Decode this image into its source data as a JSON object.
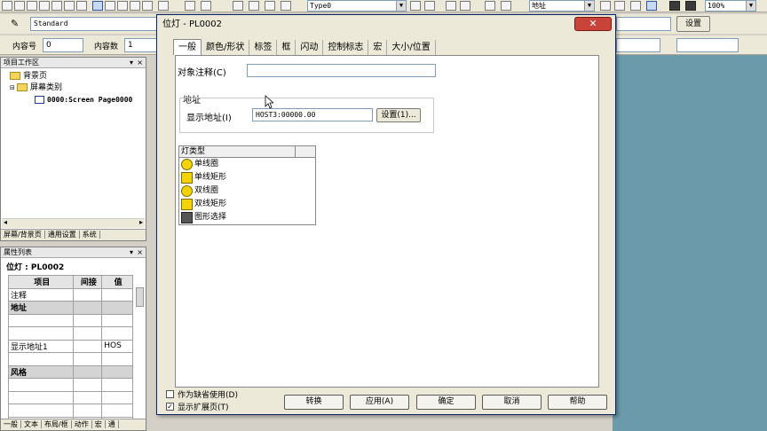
{
  "toolbar": {
    "type_combo": "Type0",
    "address_combo": "地址",
    "zoom_combo": "100%",
    "style_combo": "Standard",
    "content_no_label": "内容号",
    "content_no_value": "0",
    "content_count_label": "内容数",
    "content_count_value": "1",
    "settings_button": "设置"
  },
  "workspace": {
    "title": "项目工作区",
    "tree": [
      "背景页",
      "屏幕类别",
      "0000:Screen Page0000"
    ],
    "tabs": [
      "屏幕/背景页",
      "通用设置",
      "系统"
    ]
  },
  "properties": {
    "title": "属性列表",
    "object_name": "位灯 : PL0002",
    "headers": [
      "项目",
      "间接",
      "值"
    ],
    "rows": [
      {
        "item": "注释",
        "indirect": "",
        "value": "",
        "section": false
      },
      {
        "item": "地址",
        "indirect": "",
        "value": "",
        "section": true
      },
      {
        "item": "",
        "indirect": "",
        "value": "",
        "section": false
      },
      {
        "item": "",
        "indirect": "",
        "value": "",
        "section": false
      },
      {
        "item": "显示地址1",
        "indirect": "",
        "value": "HOS",
        "section": false
      },
      {
        "item": "",
        "indirect": "",
        "value": "",
        "section": false
      },
      {
        "item": "风格",
        "indirect": "",
        "value": "",
        "section": true
      },
      {
        "item": "",
        "indirect": "",
        "value": "",
        "section": false
      },
      {
        "item": "",
        "indirect": "",
        "value": "",
        "section": false
      },
      {
        "item": "",
        "indirect": "",
        "value": "",
        "section": false
      },
      {
        "item": "",
        "indirect": "",
        "value": "",
        "section": false
      }
    ],
    "tabs": [
      "一般",
      "文本",
      "布局/框",
      "动作",
      "宏",
      "通"
    ]
  },
  "dialog": {
    "title": "位灯 - PL0002",
    "tabs": [
      "一般",
      "颜色/形状",
      "标签",
      "框",
      "闪动",
      "控制标志",
      "宏",
      "大小/位置"
    ],
    "comment_label": "对象注释(C)",
    "comment_value": "",
    "address_group": "地址",
    "display_address_label": "显示地址(I)",
    "display_address_value": "HOST3:00000.00",
    "settings_button": "设置(1)...",
    "lamp_header": "灯类型",
    "lamp_types": [
      {
        "label": "单线圈",
        "icon": "circle-lamp-icon"
      },
      {
        "label": "单线矩形",
        "icon": "square-lamp-icon"
      },
      {
        "label": "双线圈",
        "icon": "circle-lamp-icon"
      },
      {
        "label": "双线矩形",
        "icon": "square-lamp-icon"
      },
      {
        "label": "图形选择",
        "icon": "graphic-lamp-icon"
      }
    ],
    "use_as_default": "作为缺省使用(D)",
    "show_extended": "显示扩展页(T)",
    "show_extended_checked": "✓",
    "buttons": [
      "转换",
      "应用(A)",
      "确定",
      "取消",
      "帮助"
    ]
  },
  "colors": {
    "canvas": "#6b9bab",
    "dialog_title": "#ece9d8",
    "close_button": "#c8443a",
    "lamp_yellow": "#f5d300"
  }
}
